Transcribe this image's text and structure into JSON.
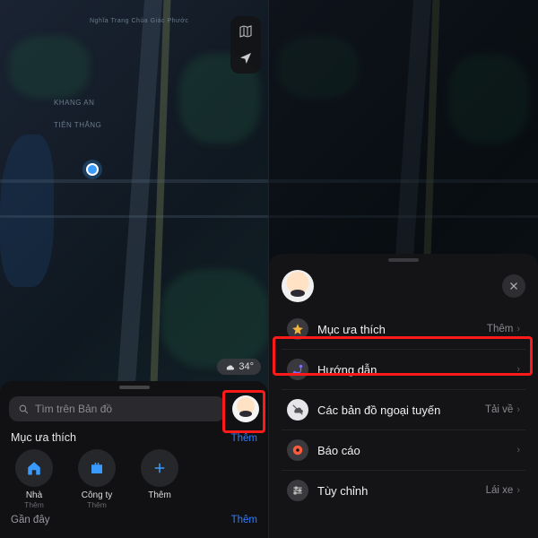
{
  "left": {
    "map_labels": {
      "district1": "KHANG AN",
      "district2": "TIÊN THẮNG",
      "poi_top": "Nghĩa Trang Chùa Giác Phước"
    },
    "weather": {
      "temp": "34°"
    },
    "search": {
      "placeholder": "Tìm trên Bản đồ"
    },
    "favorites": {
      "title": "Mục ưa thích",
      "action": "Thêm",
      "items": [
        {
          "label": "Nhà",
          "sub": "Thêm"
        },
        {
          "label": "Công ty",
          "sub": "Thêm"
        },
        {
          "label": "Thêm",
          "sub": ""
        }
      ]
    },
    "recent": {
      "title": "Gần đây",
      "action": "Thêm"
    }
  },
  "right": {
    "menu": [
      {
        "label": "Mục ưa thích",
        "tail": "Thêm"
      },
      {
        "label": "Hướng dẫn",
        "tail": ""
      },
      {
        "label": "Các bản đồ ngoại tuyến",
        "tail": "Tải về"
      },
      {
        "label": "Báo cáo",
        "tail": ""
      },
      {
        "label": "Tùy chỉnh",
        "tail": "Lái xe"
      }
    ]
  }
}
